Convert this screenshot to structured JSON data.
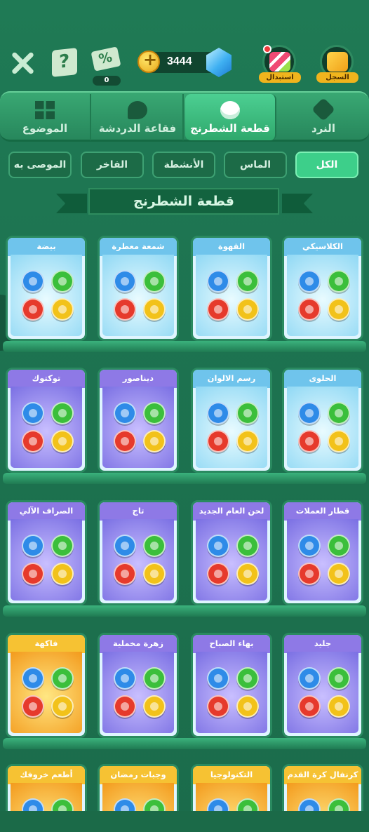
{
  "topbar": {
    "coupon_value": "0",
    "coupon_symbol": "%",
    "help_symbol": "?",
    "coins_value": "3444",
    "coin_symbol": "+",
    "exchange_label": "استبدال",
    "record_label": "السجل"
  },
  "tabs": [
    {
      "label": "الموضوع",
      "icon": "grid-icon"
    },
    {
      "label": "فقاعة الدردشة",
      "icon": "chat-bubble-icon"
    },
    {
      "label": "قطعة الشطرنج",
      "icon": "chess-piece-icon",
      "active": true
    },
    {
      "label": "النرد",
      "icon": "dice-icon"
    }
  ],
  "filters": [
    {
      "label": "الموصى به"
    },
    {
      "label": "الفاخر"
    },
    {
      "label": "الأنشطة"
    },
    {
      "label": "الماس"
    },
    {
      "label": "الكل",
      "active": true
    }
  ],
  "section_title": "قطعة الشطرنج",
  "rows": [
    [
      {
        "name": "بيضة",
        "theme": "blue"
      },
      {
        "name": "شمعة معطرة",
        "theme": "blue"
      },
      {
        "name": "القهوة",
        "theme": "blue"
      },
      {
        "name": "الكلاسيكي",
        "theme": "blue"
      }
    ],
    [
      {
        "name": "توكتوك",
        "theme": "purple"
      },
      {
        "name": "ديناصور",
        "theme": "purple"
      },
      {
        "name": "رسم الالوان",
        "theme": "blue"
      },
      {
        "name": "الحلوى",
        "theme": "blue"
      }
    ],
    [
      {
        "name": "الصراف الآلي",
        "theme": "purple"
      },
      {
        "name": "تاج",
        "theme": "purple"
      },
      {
        "name": "لحن العام الجديد",
        "theme": "purple"
      },
      {
        "name": "قطار العملات",
        "theme": "purple"
      }
    ],
    [
      {
        "name": "فاكهة",
        "theme": "gold"
      },
      {
        "name": "زهرة مخملية",
        "theme": "purple"
      },
      {
        "name": "بهاء الصباح",
        "theme": "purple"
      },
      {
        "name": "جليد",
        "theme": "purple"
      }
    ],
    [
      {
        "name": "أطعم خروفك",
        "theme": "gold"
      },
      {
        "name": "وجبات رمضان الشهية",
        "theme": "gold"
      },
      {
        "name": "التكنولوجيا",
        "theme": "gold"
      },
      {
        "name": "كرنفال كرة القدم",
        "theme": "gold"
      }
    ]
  ],
  "colors": {
    "background": "#1d7350",
    "active_tab": "#3dcf8a",
    "card_blue": "#6fc4ec",
    "card_purple": "#8e79e6",
    "card_gold": "#f6c233"
  }
}
